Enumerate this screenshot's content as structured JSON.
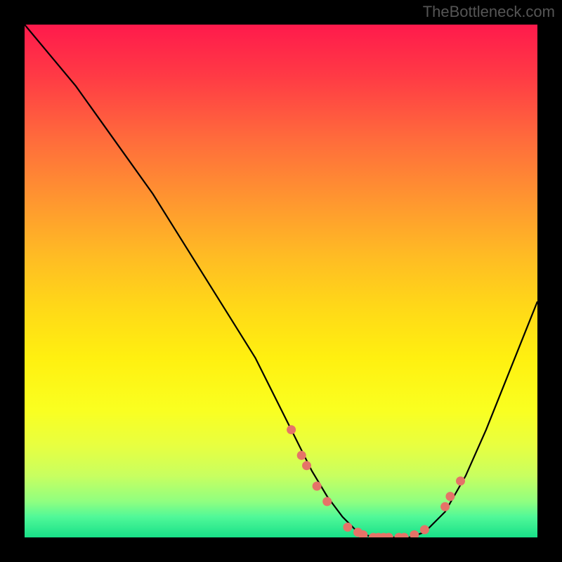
{
  "watermark": "TheBottleneck.com",
  "chart_data": {
    "type": "line",
    "title": "",
    "xlabel": "",
    "ylabel": "",
    "xlim": [
      0,
      100
    ],
    "ylim": [
      0,
      100
    ],
    "grid": false,
    "legend": false,
    "series": [
      {
        "name": "bottleneck-curve",
        "color": "#000000",
        "x": [
          0,
          5,
          10,
          15,
          20,
          25,
          30,
          35,
          40,
          45,
          50,
          53,
          56,
          59,
          62,
          65,
          68,
          71,
          73,
          75,
          78,
          82,
          86,
          90,
          94,
          98,
          100
        ],
        "y": [
          100,
          94,
          88,
          81,
          74,
          67,
          59,
          51,
          43,
          35,
          25,
          19,
          13,
          8,
          4,
          1,
          0,
          0,
          0,
          0,
          1,
          5,
          12,
          21,
          31,
          41,
          46
        ]
      }
    ],
    "markers": {
      "name": "highlighted-points",
      "color": "#e57368",
      "points": [
        {
          "x": 52,
          "y": 21
        },
        {
          "x": 54,
          "y": 16
        },
        {
          "x": 55,
          "y": 14
        },
        {
          "x": 57,
          "y": 10
        },
        {
          "x": 59,
          "y": 7
        },
        {
          "x": 63,
          "y": 2
        },
        {
          "x": 65,
          "y": 1
        },
        {
          "x": 66,
          "y": 0.5
        },
        {
          "x": 68,
          "y": 0
        },
        {
          "x": 69,
          "y": 0
        },
        {
          "x": 70,
          "y": 0
        },
        {
          "x": 71,
          "y": 0
        },
        {
          "x": 73,
          "y": 0
        },
        {
          "x": 74,
          "y": 0
        },
        {
          "x": 76,
          "y": 0.5
        },
        {
          "x": 78,
          "y": 1.5
        },
        {
          "x": 82,
          "y": 6
        },
        {
          "x": 83,
          "y": 8
        },
        {
          "x": 85,
          "y": 11
        }
      ]
    },
    "gradient": {
      "description": "vertical gradient background red-to-green representing bottleneck severity",
      "stops": [
        {
          "offset": 0,
          "color": "#ff1a4c"
        },
        {
          "offset": 100,
          "color": "#18e088"
        }
      ]
    }
  }
}
